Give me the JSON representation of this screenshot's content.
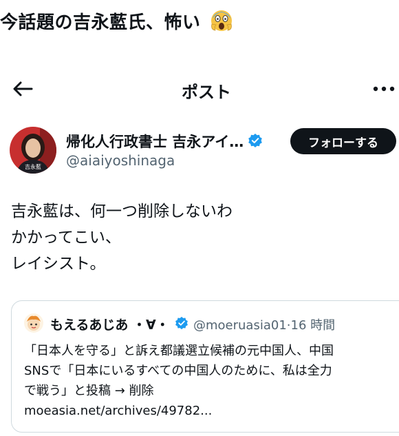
{
  "caption": {
    "text": "今話題の吉永藍氏、怖い",
    "emoji": "screaming-face-emoji"
  },
  "topbar": {
    "title": "ポスト"
  },
  "author": {
    "display_name": "帰化人行政書士 吉永アイ…",
    "handle": "@aiaiyoshinaga",
    "avatar_caption": "吉永藍",
    "follow_label": "フォローする"
  },
  "tweet": {
    "lines": [
      "吉永藍は、何一つ削除しないわ",
      "かかってこい、",
      "レイシスト。"
    ]
  },
  "quote": {
    "display_name": "もえるあじあ ・∀・",
    "meta": "@moeruasia01·16 時間",
    "lines": [
      "「日本人を守る」と訴え都議選立候補の元中国人、中国",
      "SNSで「日本にいるすべての中国人のために、私は全力",
      "で戦う」と投稿 → 削除",
      "moeasia.net/archives/49782..."
    ]
  },
  "colors": {
    "text": "#0f1419",
    "secondary": "#536471",
    "verified": "#1d9bf0",
    "border": "#cfd9de"
  }
}
